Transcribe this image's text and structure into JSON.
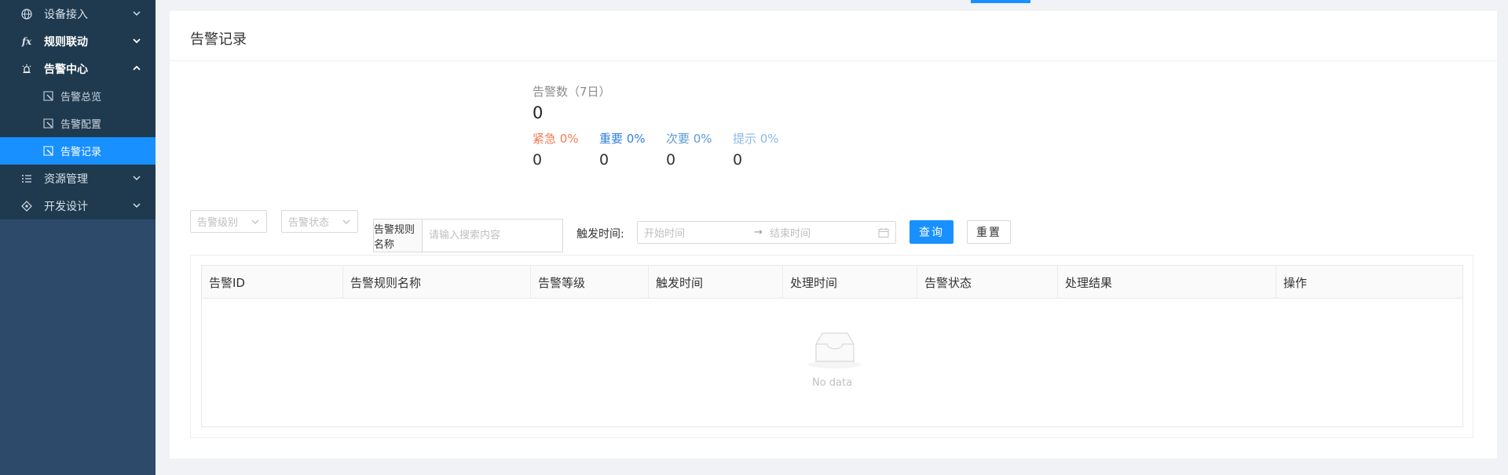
{
  "sidebar": {
    "items": [
      {
        "label": "设备接入",
        "icon": "globe-icon"
      },
      {
        "label": "规则联动",
        "icon": "fx-icon",
        "glyph": "fx"
      },
      {
        "label": "告警中心",
        "icon": "alarm-icon"
      },
      {
        "label": "告警总览",
        "icon": "alert-doc-icon"
      },
      {
        "label": "告警配置",
        "icon": "alert-doc-icon"
      },
      {
        "label": "告警记录",
        "icon": "alert-doc-icon"
      },
      {
        "label": "资源管理",
        "icon": "list-icon"
      },
      {
        "label": "开发设计",
        "icon": "design-icon"
      }
    ]
  },
  "page": {
    "title": "告警记录"
  },
  "stats": {
    "label": "告警数（7日）",
    "total": "0",
    "levels": [
      {
        "label": "紧急 0%",
        "value": "0",
        "color": "#f47b52"
      },
      {
        "label": "重要 0%",
        "value": "0",
        "color": "#2f7fe0"
      },
      {
        "label": "次要 0%",
        "value": "0",
        "color": "#5b9bd5"
      },
      {
        "label": "提示 0%",
        "value": "0",
        "color": "#8ab7ee"
      }
    ]
  },
  "filters": {
    "level_placeholder": "告警级别",
    "status_placeholder": "告警状态",
    "rule_addon": "告警规则名称",
    "rule_placeholder": "请输入搜索内容",
    "trigger_label": "触发时间:",
    "start_placeholder": "开始时间",
    "range_separator": "→",
    "end_placeholder": "结束时间",
    "query_label": "查询",
    "reset_label": "重置"
  },
  "table": {
    "columns": [
      "告警ID",
      "告警规则名称",
      "告警等级",
      "触发时间",
      "处理时间",
      "告警状态",
      "处理结果",
      "操作"
    ],
    "empty_text": "No data"
  },
  "colors": {
    "accent": "#1890ff",
    "sidebar_bg": "#2d4a6b",
    "menu_bg": "#1f3a4e"
  }
}
